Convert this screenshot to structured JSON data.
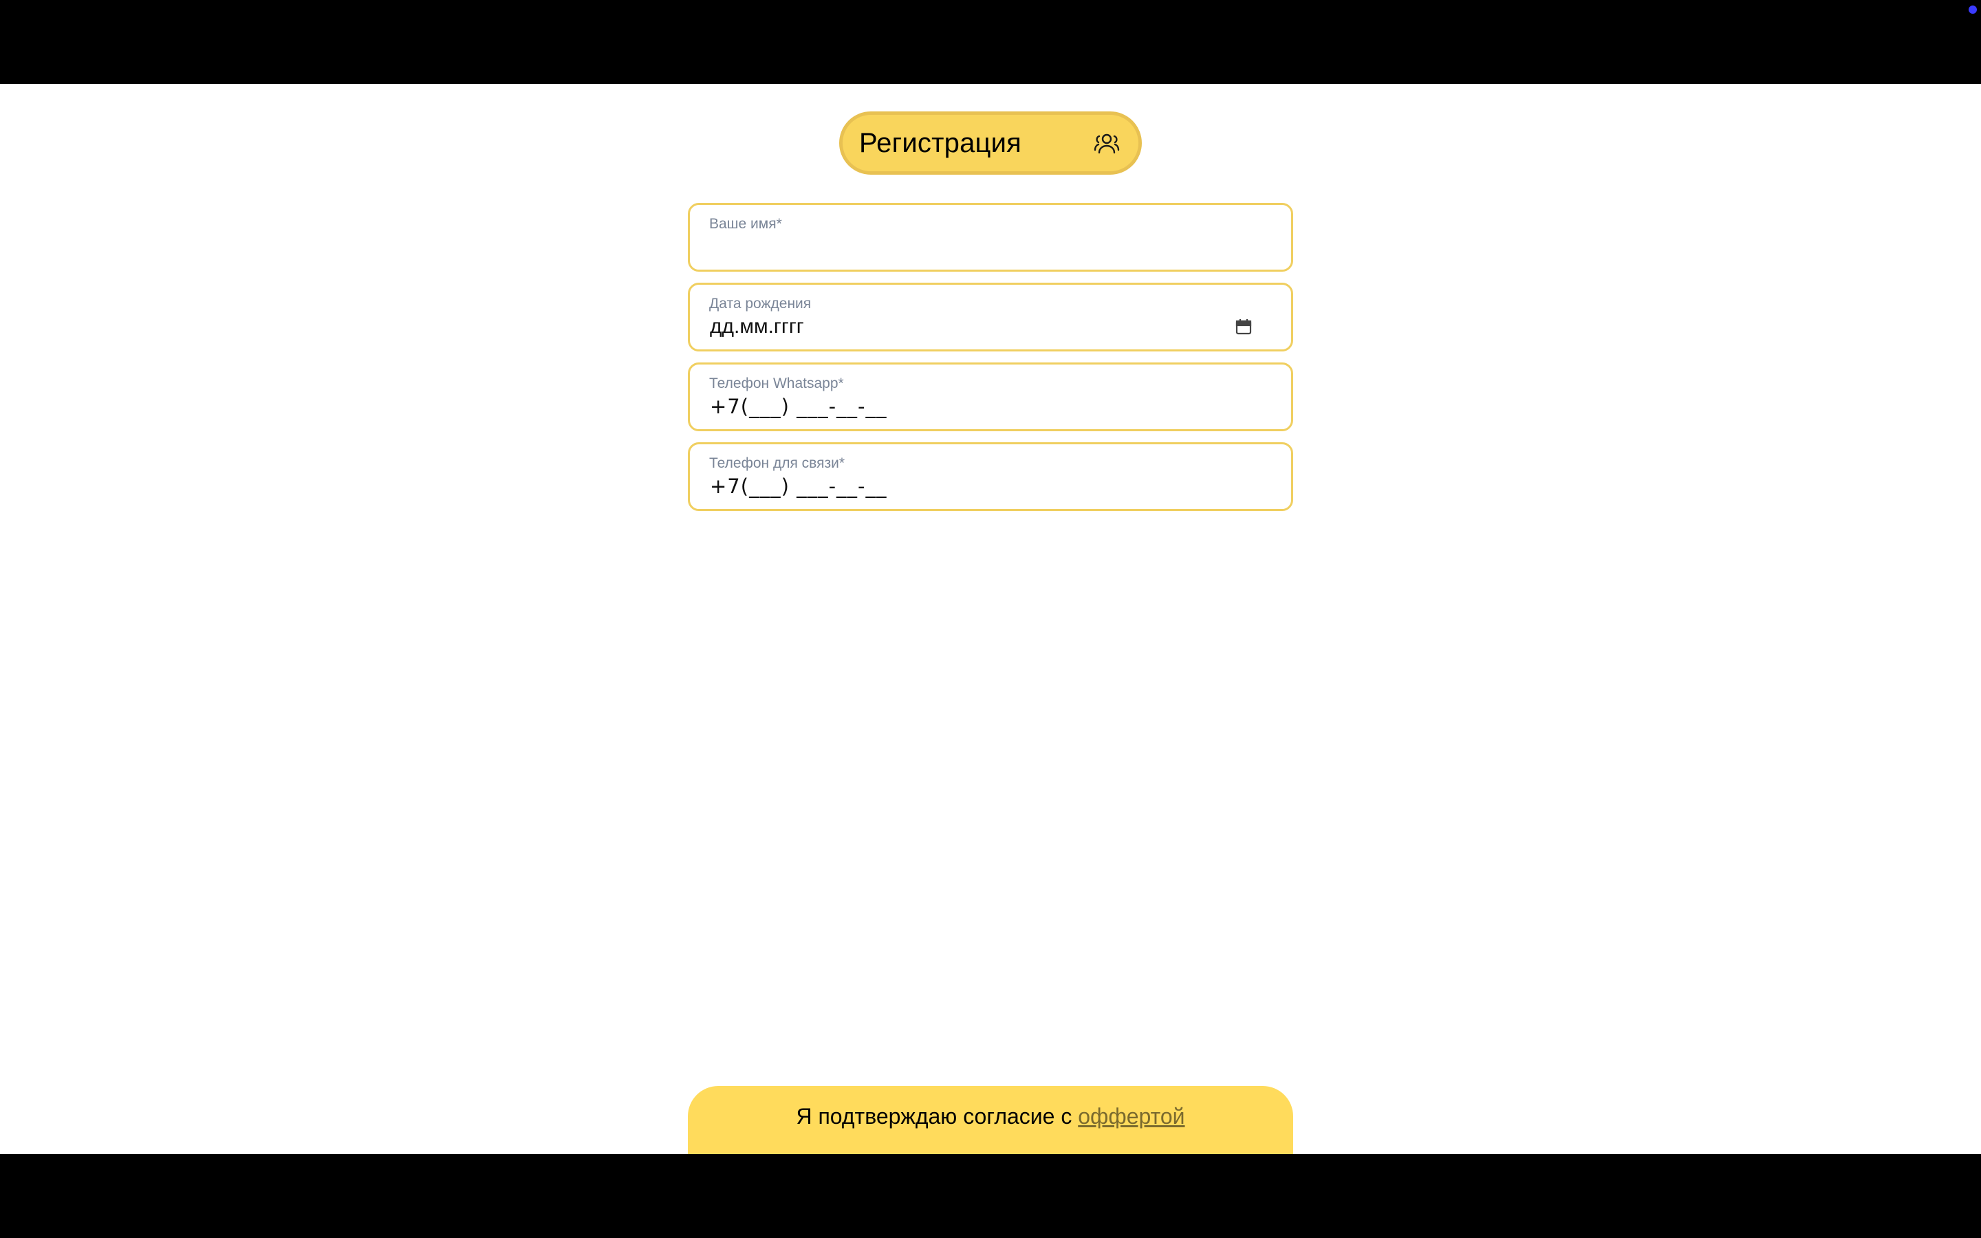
{
  "header": {
    "title": "Регистрация",
    "icon": "users-icon"
  },
  "form": {
    "fields": [
      {
        "label": "Ваше имя*",
        "value": ""
      },
      {
        "label": "Дата рождения",
        "value": "дд.мм.гггг",
        "icon": "calendar-icon"
      },
      {
        "label": "Телефон Whatsapp*",
        "value": "+7(___) ___-__-__"
      },
      {
        "label": "Телефон для связи*",
        "value": "+7(___) ___-__-__"
      }
    ]
  },
  "consent": {
    "text": "Я подтверждаю согласие с ",
    "link_label": "оффертой"
  },
  "colors": {
    "accent": "#ffdb5c",
    "field_border": "#f0cf60",
    "label": "#7a8597",
    "status_dot": "#3b3bff"
  }
}
